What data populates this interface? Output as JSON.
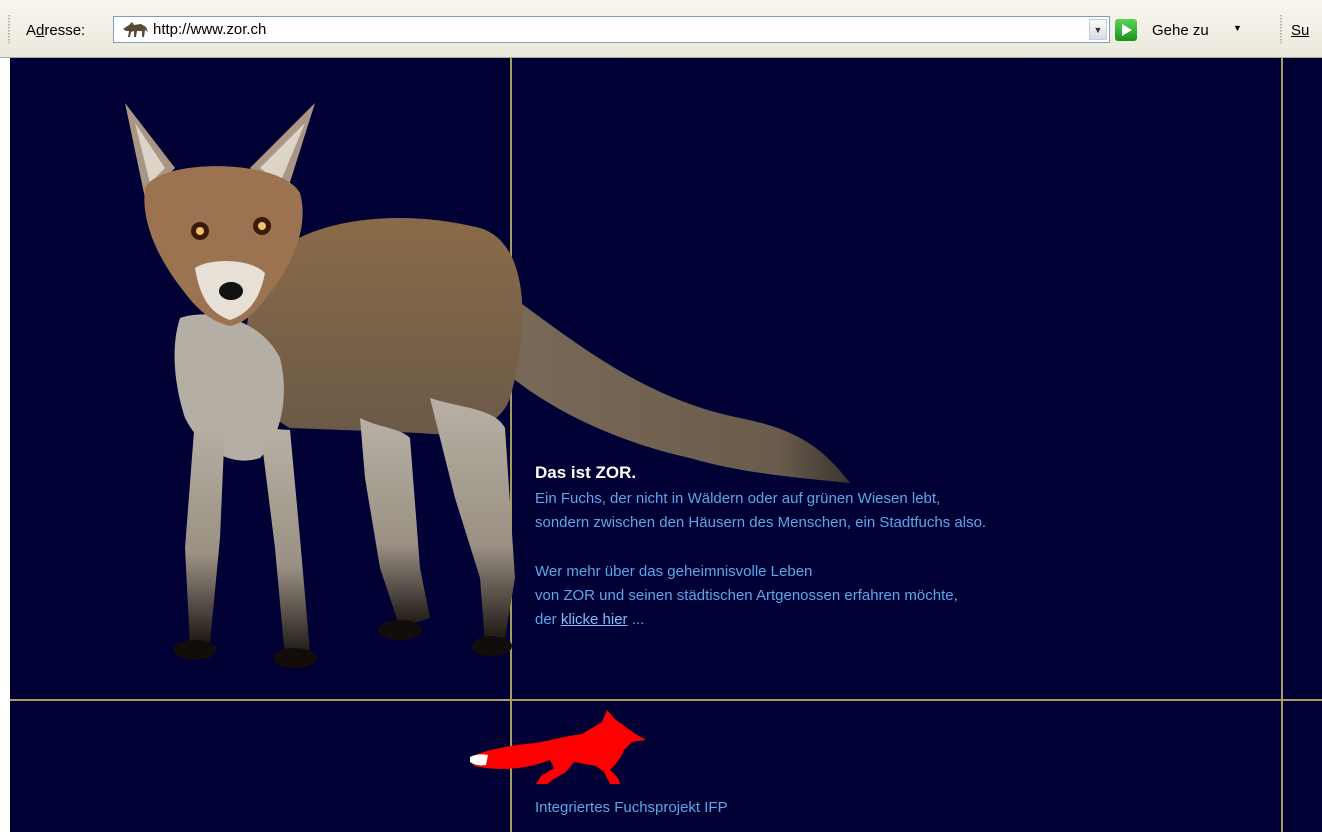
{
  "toolbar": {
    "address_label_prefix": "A",
    "address_label_accel": "d",
    "address_label_rest": "resse:",
    "url": "http://www.zor.ch",
    "go_label": "Gehe zu",
    "search_label": "Su"
  },
  "content": {
    "title": "Das ist ZOR.",
    "line1": "Ein Fuchs, der nicht in Wäldern oder auf grünen Wiesen lebt,",
    "line2": "sondern zwischen den Häusern des Menschen, ein Stadtfuchs also.",
    "line3": "Wer mehr über das geheimnisvolle Leben",
    "line4": "von ZOR und seinen städtischen Artgenossen erfahren möchte,",
    "line5_prefix": "der",
    "link_text": "klicke hier",
    "line5_suffix": "..."
  },
  "footer": {
    "project_name": "Integriertes Fuchsprojekt IFP"
  },
  "colors": {
    "background": "#000035",
    "frame_lines": "#a59c61",
    "text": "#5aa7e8",
    "logo_fox": "#ff0000"
  }
}
